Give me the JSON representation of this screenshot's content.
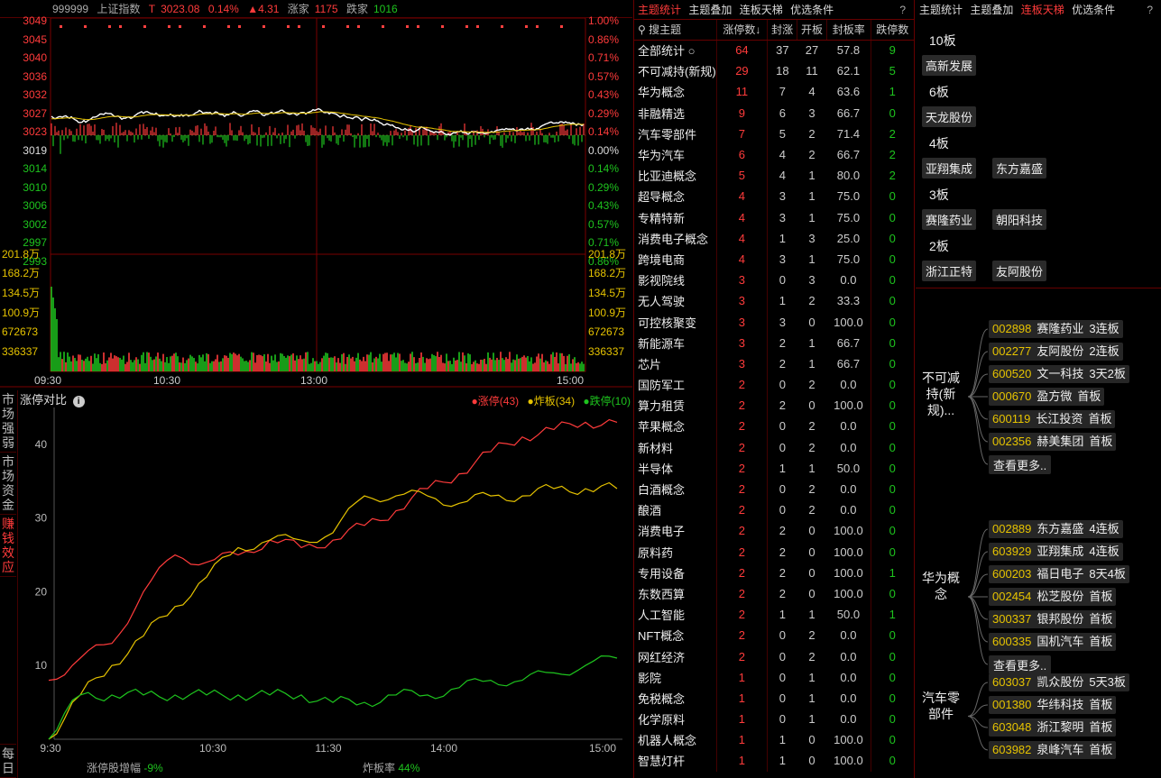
{
  "header": {
    "code": "999999",
    "name": "上证指数",
    "t_label": "T",
    "price": "3023.08",
    "pct": "0.14%",
    "change": "▲4.31",
    "up_label": "涨家",
    "up_count": "1175",
    "down_label": "跌家",
    "down_count": "1016"
  },
  "price_axis": {
    "left": [
      "3049",
      "3045",
      "3040",
      "3036",
      "3032",
      "3027",
      "3023",
      "3019",
      "3014",
      "3010",
      "3006",
      "3002",
      "2997",
      "2993"
    ],
    "right": [
      "1.00%",
      "0.86%",
      "0.71%",
      "0.57%",
      "0.43%",
      "0.29%",
      "0.14%",
      "0.00%",
      "0.14%",
      "0.29%",
      "0.43%",
      "0.57%",
      "0.71%",
      "0.86%"
    ]
  },
  "volume_axis": {
    "left": [
      "201.8万",
      "168.2万",
      "134.5万",
      "100.9万",
      "672673",
      "336337"
    ],
    "right": [
      "201.8万",
      "168.2万",
      "134.5万",
      "100.9万",
      "672673",
      "336337"
    ]
  },
  "time_axis": [
    "09:30",
    "10:30",
    "13:00",
    "15:00"
  ],
  "sidebar_tabs": [
    "市场强弱",
    "市场资金",
    "赚钱效应",
    "每日"
  ],
  "compare": {
    "title": "涨停对比",
    "legend": [
      {
        "label": "涨停(43)",
        "color": "#ff3b3b"
      },
      {
        "label": "炸板(34)",
        "color": "#e6c300"
      },
      {
        "label": "跌停(10)",
        "color": "#1ec41e"
      }
    ],
    "footer_left_label": "涨停股增幅",
    "footer_left_value": "-9%",
    "footer_right_label": "炸板率",
    "footer_right_value": "44%"
  },
  "chart_data": {
    "type": "line",
    "x": [
      "9:30",
      "10:30",
      "11:30",
      "14:00",
      "15:00"
    ],
    "ylim": [
      0,
      45
    ],
    "yticks": [
      10,
      20,
      30,
      40
    ],
    "series": [
      {
        "name": "涨停",
        "color": "#ff3b3b",
        "values": [
          8,
          11,
          13,
          20,
          25,
          24,
          25,
          27,
          26,
          27,
          29,
          31,
          34,
          36,
          39,
          41,
          42,
          43,
          43
        ]
      },
      {
        "name": "炸板",
        "color": "#e6c300",
        "values": [
          0,
          6,
          10,
          14,
          18,
          22,
          26,
          27,
          27,
          28,
          33,
          33,
          33,
          32,
          33,
          33,
          34,
          34,
          34
        ]
      },
      {
        "name": "跌停",
        "color": "#1ec41e",
        "values": [
          0,
          6,
          6,
          6,
          6,
          6,
          6,
          6,
          6,
          5,
          5,
          6,
          6,
          7,
          8,
          8,
          9,
          10,
          11
        ]
      }
    ]
  },
  "table_tabs": [
    "主题统计",
    "主题叠加",
    "连板天梯",
    "优选条件"
  ],
  "table_tab_active": 0,
  "help": "?",
  "table_header": [
    "搜主题",
    "涨停数↓",
    "封涨",
    "开板",
    "封板率",
    "跌停数"
  ],
  "table_rows": [
    [
      "全部统计",
      "64",
      "37",
      "27",
      "57.8",
      "9"
    ],
    [
      "不可减持(新规)",
      "29",
      "18",
      "11",
      "62.1",
      "5"
    ],
    [
      "华为概念",
      "11",
      "7",
      "4",
      "63.6",
      "1"
    ],
    [
      "非融精选",
      "9",
      "6",
      "3",
      "66.7",
      "0"
    ],
    [
      "汽车零部件",
      "7",
      "5",
      "2",
      "71.4",
      "2"
    ],
    [
      "华为汽车",
      "6",
      "4",
      "2",
      "66.7",
      "2"
    ],
    [
      "比亚迪概念",
      "5",
      "4",
      "1",
      "80.0",
      "2"
    ],
    [
      "超导概念",
      "4",
      "3",
      "1",
      "75.0",
      "0"
    ],
    [
      "专精特新",
      "4",
      "3",
      "1",
      "75.0",
      "0"
    ],
    [
      "消费电子概念",
      "4",
      "1",
      "3",
      "25.0",
      "0"
    ],
    [
      "跨境电商",
      "4",
      "3",
      "1",
      "75.0",
      "0"
    ],
    [
      "影视院线",
      "3",
      "0",
      "3",
      "0.0",
      "0"
    ],
    [
      "无人驾驶",
      "3",
      "1",
      "2",
      "33.3",
      "0"
    ],
    [
      "可控核聚变",
      "3",
      "3",
      "0",
      "100.0",
      "0"
    ],
    [
      "新能源车",
      "3",
      "2",
      "1",
      "66.7",
      "0"
    ],
    [
      "芯片",
      "3",
      "2",
      "1",
      "66.7",
      "0"
    ],
    [
      "国防军工",
      "2",
      "0",
      "2",
      "0.0",
      "0"
    ],
    [
      "算力租赁",
      "2",
      "2",
      "0",
      "100.0",
      "0"
    ],
    [
      "苹果概念",
      "2",
      "0",
      "2",
      "0.0",
      "0"
    ],
    [
      "新材料",
      "2",
      "0",
      "2",
      "0.0",
      "0"
    ],
    [
      "半导体",
      "2",
      "1",
      "1",
      "50.0",
      "0"
    ],
    [
      "白酒概念",
      "2",
      "0",
      "2",
      "0.0",
      "0"
    ],
    [
      "酿酒",
      "2",
      "0",
      "2",
      "0.0",
      "0"
    ],
    [
      "消费电子",
      "2",
      "2",
      "0",
      "100.0",
      "0"
    ],
    [
      "原料药",
      "2",
      "2",
      "0",
      "100.0",
      "0"
    ],
    [
      "专用设备",
      "2",
      "2",
      "0",
      "100.0",
      "1"
    ],
    [
      "东数西算",
      "2",
      "2",
      "0",
      "100.0",
      "0"
    ],
    [
      "人工智能",
      "2",
      "1",
      "1",
      "50.0",
      "1"
    ],
    [
      "NFT概念",
      "2",
      "0",
      "2",
      "0.0",
      "0"
    ],
    [
      "网红经济",
      "2",
      "0",
      "2",
      "0.0",
      "0"
    ],
    [
      "影院",
      "1",
      "0",
      "1",
      "0.0",
      "0"
    ],
    [
      "免税概念",
      "1",
      "0",
      "1",
      "0.0",
      "0"
    ],
    [
      "化学原料",
      "1",
      "0",
      "1",
      "0.0",
      "0"
    ],
    [
      "机器人概念",
      "1",
      "1",
      "0",
      "100.0",
      "0"
    ],
    [
      "智慧灯杆",
      "1",
      "1",
      "0",
      "100.0",
      "0"
    ]
  ],
  "ladder_tabs": [
    "主题统计",
    "主题叠加",
    "连板天梯",
    "优选条件"
  ],
  "ladder_tab_active": 2,
  "ladder": [
    {
      "level": "10板",
      "stocks": [
        "高新发展"
      ]
    },
    {
      "level": "6板",
      "stocks": [
        "天龙股份"
      ]
    },
    {
      "level": "4板",
      "stocks": [
        "亚翔集成",
        "东方嘉盛"
      ]
    },
    {
      "level": "3板",
      "stocks": [
        "赛隆药业",
        "朝阳科技"
      ]
    },
    {
      "level": "2板",
      "stocks": [
        "浙江正特",
        "友阿股份"
      ]
    }
  ],
  "groups": [
    {
      "name": "不可减持(新规)...",
      "items": [
        {
          "code": "002898",
          "name": "赛隆药业",
          "board": "3连板"
        },
        {
          "code": "002277",
          "name": "友阿股份",
          "board": "2连板"
        },
        {
          "code": "600520",
          "name": "文一科技",
          "board": "3天2板"
        },
        {
          "code": "000670",
          "name": "盈方微",
          "board": "首板"
        },
        {
          "code": "600119",
          "name": "长江投资",
          "board": "首板"
        },
        {
          "code": "002356",
          "name": "赫美集团",
          "board": "首板"
        }
      ]
    },
    {
      "name": "华为概念",
      "items": [
        {
          "code": "002889",
          "name": "东方嘉盛",
          "board": "4连板"
        },
        {
          "code": "603929",
          "name": "亚翔集成",
          "board": "4连板"
        },
        {
          "code": "600203",
          "name": "福日电子",
          "board": "8天4板"
        },
        {
          "code": "002454",
          "name": "松芝股份",
          "board": "首板"
        },
        {
          "code": "300337",
          "name": "银邦股份",
          "board": "首板"
        },
        {
          "code": "600335",
          "name": "国机汽车",
          "board": "首板"
        }
      ]
    },
    {
      "name": "汽车零部件",
      "items": [
        {
          "code": "603037",
          "name": "凯众股份",
          "board": "5天3板"
        },
        {
          "code": "001380",
          "name": "华纬科技",
          "board": "首板"
        },
        {
          "code": "603048",
          "name": "浙江黎明",
          "board": "首板"
        },
        {
          "code": "603982",
          "name": "泉峰汽车",
          "board": "首板"
        }
      ]
    }
  ],
  "more_label": "查看更多.."
}
